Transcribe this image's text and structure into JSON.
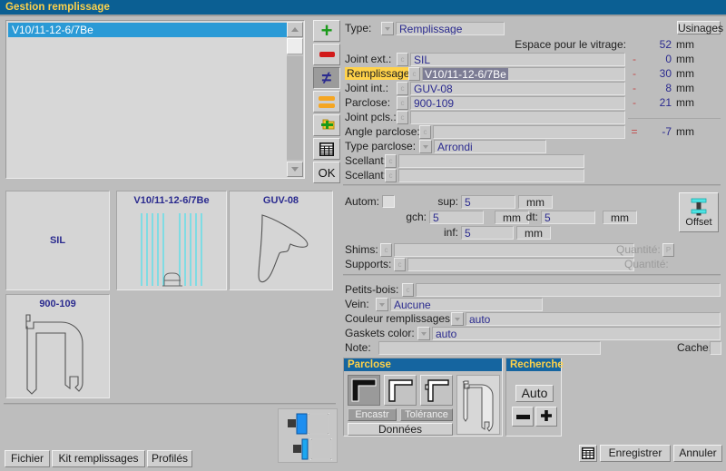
{
  "window": {
    "title": "Gestion remplissage"
  },
  "list": {
    "items": [
      "V10/11-12-6/7Be"
    ]
  },
  "toolbar": {
    "add_label": "+",
    "remove_label": "–",
    "swap_label": "≠",
    "equal_label": "=",
    "add_folder_label": "+",
    "table_label": "grid",
    "ok_label": "OK"
  },
  "form": {
    "type_label": "Type:",
    "type_value": "Remplissage",
    "usinages_button": "Usinages",
    "espace_label": "Espace pour le vitrage:",
    "espace_value": "52",
    "espace_unit": "mm",
    "rows": [
      {
        "label": "Joint ext.:",
        "value": "SIL",
        "sep": "-",
        "dim": "0",
        "unit": "mm",
        "highlighted": false,
        "selected": false
      },
      {
        "label": "Remplissage:",
        "value": "V10/11-12-6/7Be",
        "sep": "-",
        "dim": "30",
        "unit": "mm",
        "highlighted": true,
        "selected": true
      },
      {
        "label": "Joint int.:",
        "value": "GUV-08",
        "sep": "-",
        "dim": "8",
        "unit": "mm",
        "highlighted": false,
        "selected": false
      },
      {
        "label": "Parclose:",
        "value": "900-109",
        "sep": "-",
        "dim": "21",
        "unit": "mm",
        "highlighted": false,
        "selected": false
      },
      {
        "label": "Joint pcls.:",
        "value": "",
        "sep": "",
        "dim": "",
        "unit": "",
        "highlighted": false,
        "selected": false
      }
    ],
    "angle_label": "Angle parclose:",
    "angle_value": "",
    "angle_sep": "=",
    "angle_dim": "-7",
    "angle_unit": "mm",
    "type_parclose_label": "Type parclose:",
    "type_parclose_value": "Arrondi",
    "scellant1_label": "Scellant:",
    "scellant1_value": "",
    "scellant2_label": "Scellant:",
    "scellant2_value": ""
  },
  "autom": {
    "label": "Autom:",
    "checked": false,
    "sup_label": "sup:",
    "sup_value": "5",
    "sup_unit": "mm",
    "gch_label": "gch:",
    "gch_value": "5",
    "gch_unit": "mm",
    "dt_label": "dt:",
    "dt_value": "5",
    "dt_unit": "mm",
    "inf_label": "inf:",
    "inf_value": "5",
    "inf_unit": "mm",
    "offset_button": "Offset",
    "shims_label": "Shims:",
    "shims_value": "",
    "shims_qty_label": "Quantité:",
    "shims_qty_value": "P",
    "supports_label": "Supports:",
    "supports_value": "",
    "supports_qty_label": "Quantité:",
    "supports_qty_value": ""
  },
  "misc": {
    "petits_bois_label": "Petits-bois:",
    "petits_bois_value": "",
    "vein_label": "Vein:",
    "vein_value": "Aucune",
    "couleur_label": "Couleur remplissages:",
    "couleur_value": "auto",
    "gaskets_label": "Gaskets color:",
    "gaskets_value": "auto",
    "note_label": "Note:",
    "note_value": "",
    "cache_label": "Cache:",
    "cache_value": ""
  },
  "parclose_group": {
    "title": "Parclose",
    "encastr_button": "Encastr",
    "tolerance_button": "Tolérance",
    "donnees_button": "Données",
    "shape_buttons": [
      "corner-filled",
      "corner-thin",
      "corner-step"
    ],
    "selected_shape_index": 0
  },
  "recherche_group": {
    "title": "Recherche",
    "auto_button": "Auto",
    "minus_button": "–",
    "plus_button": "+"
  },
  "thumbnails": [
    {
      "name": "SIL",
      "title_position": "center"
    },
    {
      "name": "V10/11-12-6/7Be",
      "title_position": "top"
    },
    {
      "name": "GUV-08",
      "title_position": "top"
    },
    {
      "name": "900-109",
      "title_position": "top"
    }
  ],
  "footer": {
    "fichier_button": "Fichier",
    "kit_button": "Kit remplissages",
    "profiles_button": "Profilés",
    "enregistrer_button": "Enregistrer",
    "annuler_button": "Annuler"
  },
  "colors": {
    "titlebar_bg": "#0b5f93",
    "titlebar_fg": "#ffd24a",
    "selection_bg": "#2a9ad6",
    "value_text": "#2b2b8f",
    "group_header_bg": "#1565a0",
    "highlight_bg": "#ffd24a",
    "glass_cyan": "#46e0ee",
    "accent_red": "#c24a4a"
  }
}
